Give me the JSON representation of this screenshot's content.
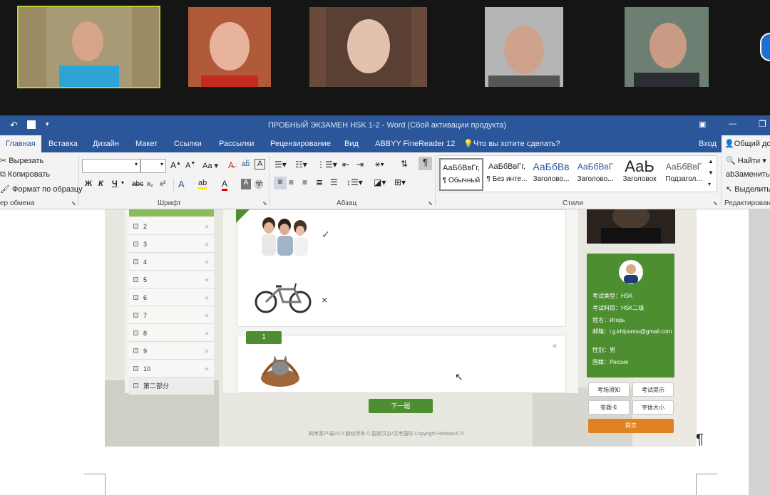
{
  "word": {
    "title": "ПРОБНЫЙ ЭКЗАМЕН HSK 1-2 - Word (Сбой активации продукта)",
    "login": "Вход",
    "share": "Общий до",
    "search_placeholder": "Что вы хотите сделать?",
    "tabs": [
      "Главная",
      "Вставка",
      "Дизайн",
      "Макет",
      "Ссылки",
      "Рассылки",
      "Рецензирование",
      "Вид",
      "ABBYY FineReader 12"
    ],
    "clipboard": {
      "cut": "Вырезать",
      "copy": "Копировать",
      "format_painter": "Формат по образцу",
      "label": "ер обмена"
    },
    "font": {
      "label": "Шрифт",
      "bold": "Ж",
      "italic": "К",
      "underline": "Ч",
      "aa": "Aa"
    },
    "paragraph": {
      "label": "Абзац"
    },
    "styles": {
      "label": "Стили",
      "items": [
        {
          "sample": "АаБбВвГг,",
          "name": "¶ Обычный"
        },
        {
          "sample": "АаБбВвГг,",
          "name": "¶ Без инте..."
        },
        {
          "sample": "АаБбВв",
          "name": "Заголово..."
        },
        {
          "sample": "АаБбВвГ",
          "name": "Заголово..."
        },
        {
          "sample": "АаЬ",
          "name": "Заголовок"
        },
        {
          "sample": "АаБбВвГ",
          "name": "Подзагол..."
        }
      ]
    },
    "editing": {
      "find": "Найти",
      "replace": "Заменить",
      "select": "Выделить",
      "label": "Редактирование"
    }
  },
  "exam": {
    "questions": [
      "2",
      "3",
      "4",
      "5",
      "6",
      "7",
      "8",
      "9",
      "10"
    ],
    "section2": "第二部分",
    "marks": [
      "✓",
      "×"
    ],
    "q_badge": "1",
    "next_button": "下一题",
    "footer": "网考客户端V3.0 版权所有 © 国家汉办/汉考国际 Copyright Hanban/CTI",
    "profile": {
      "exam_type": "考试类型：HSK",
      "exam_subject": "考试科目：HSK二级",
      "name": "姓名：Игорь",
      "email": "邮箱：i.g.khlpunov@gmail.com",
      "gender": "性别：男",
      "country": "国籍：Россия"
    },
    "buttons": [
      "考场须知",
      "考试提示",
      "答题卡",
      "字体大小"
    ],
    "submit": "提交",
    "pilcrow": "¶"
  },
  "colors": {
    "word_blue": "#2b579a",
    "exam_green": "#4d8e31",
    "submit_orange": "#e0821f"
  }
}
